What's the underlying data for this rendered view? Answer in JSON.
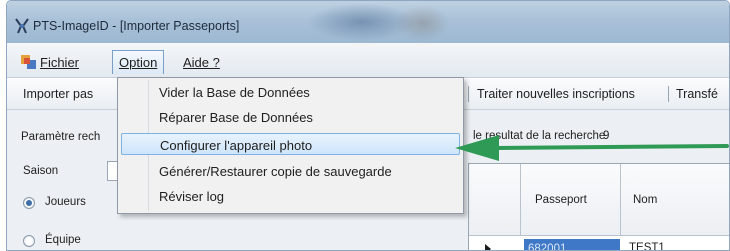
{
  "window": {
    "title": "PTS-ImageID - [Importer Passeports]"
  },
  "menubar": {
    "items": [
      {
        "label": "Fichier"
      },
      {
        "label": "Option"
      },
      {
        "label": "Aide ?"
      }
    ]
  },
  "toolbar": {
    "items": [
      {
        "label": "Importer pas"
      },
      {
        "label": "Traiter nouvelles inscriptions"
      },
      {
        "label": "Transfé"
      }
    ]
  },
  "option_menu": {
    "items": [
      {
        "label": "Vider la Base de Données"
      },
      {
        "label": "Réparer Base de Données"
      },
      {
        "label": "Configurer l'appareil photo"
      },
      {
        "label": "Générer/Restaurer copie de sauvegarde"
      },
      {
        "label": "Réviser log"
      }
    ],
    "highlighted_index": 2
  },
  "left_panel": {
    "params_label": "Paramètre rech",
    "season_label": "Saison",
    "radio_players": "Joueurs",
    "radio_team": "Équipe"
  },
  "results": {
    "label": "le resultat de la recherche",
    "count": "9"
  },
  "grid": {
    "columns": [
      "Passeport",
      "Nom"
    ],
    "rows": [
      {
        "passeport": "682001",
        "nom": "TEST1"
      }
    ]
  },
  "colors": {
    "annotation_arrow": "#2e9a55",
    "selected_cell": "#3f78c6",
    "menu_highlight_border": "#7db2e4"
  },
  "icons": {
    "app": "app-logo-icon",
    "menu": "window-menu-icon",
    "annotation": "green-arrow-icon",
    "row_indicator": "row-pointer-icon"
  }
}
